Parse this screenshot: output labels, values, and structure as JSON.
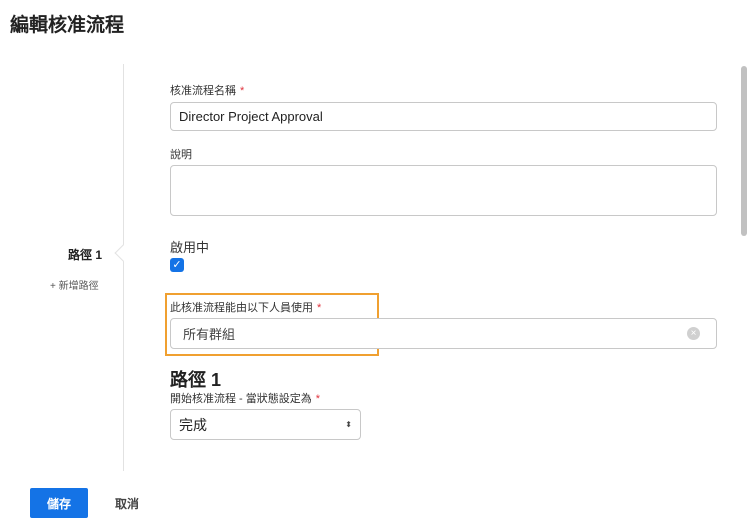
{
  "title": "編輯核准流程",
  "sidebar": {
    "path_label": "路徑 1",
    "add_path": "+ 新增路徑"
  },
  "form": {
    "name_label": "核准流程名稱",
    "name_value": "Director Project Approval",
    "desc_label": "說明",
    "desc_value": "",
    "active_label": "啟用中",
    "active_checked": true,
    "usable_by_label": "此核准流程能由以下人員使用",
    "usable_by_value": "所有群組",
    "path_heading": "路徑 1",
    "status_label": "開始核准流程 - 當狀態設定為",
    "status_value": "完成",
    "required_mark": "*"
  },
  "footer": {
    "save": "儲存",
    "cancel": "取消"
  },
  "colors": {
    "accent": "#1473e6",
    "highlight": "#f0a030",
    "required": "#e0323c"
  }
}
